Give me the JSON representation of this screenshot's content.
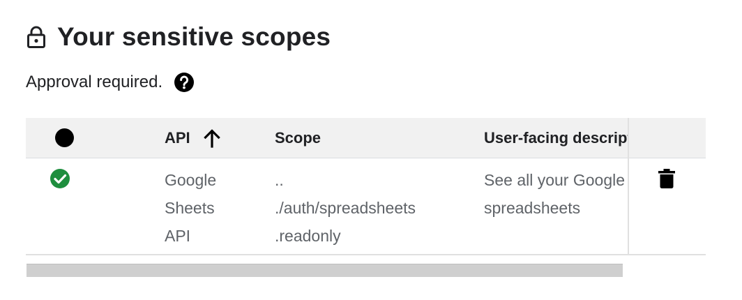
{
  "header": {
    "title": "Your sensitive scopes",
    "subtitle": "Approval required."
  },
  "icons": {
    "title": "lock-icon",
    "help": "help-circle-icon",
    "sort": "arrow-up-icon",
    "status": "check-circle-icon",
    "delete": "trash-icon"
  },
  "colors": {
    "approved": "#1e8e3e",
    "header_bg": "#f1f1f1",
    "muted_text": "#5f6368"
  },
  "table": {
    "columns": {
      "api": "API",
      "scope": "Scope",
      "description": "User-facing description"
    },
    "rows": [
      {
        "api_lines": [
          "Google",
          "Sheets",
          "API"
        ],
        "scope_lines": [
          "..",
          "./auth/spreadsheets",
          ".readonly"
        ],
        "description_lines": [
          "See all your Google",
          "spreadsheets"
        ]
      }
    ]
  }
}
